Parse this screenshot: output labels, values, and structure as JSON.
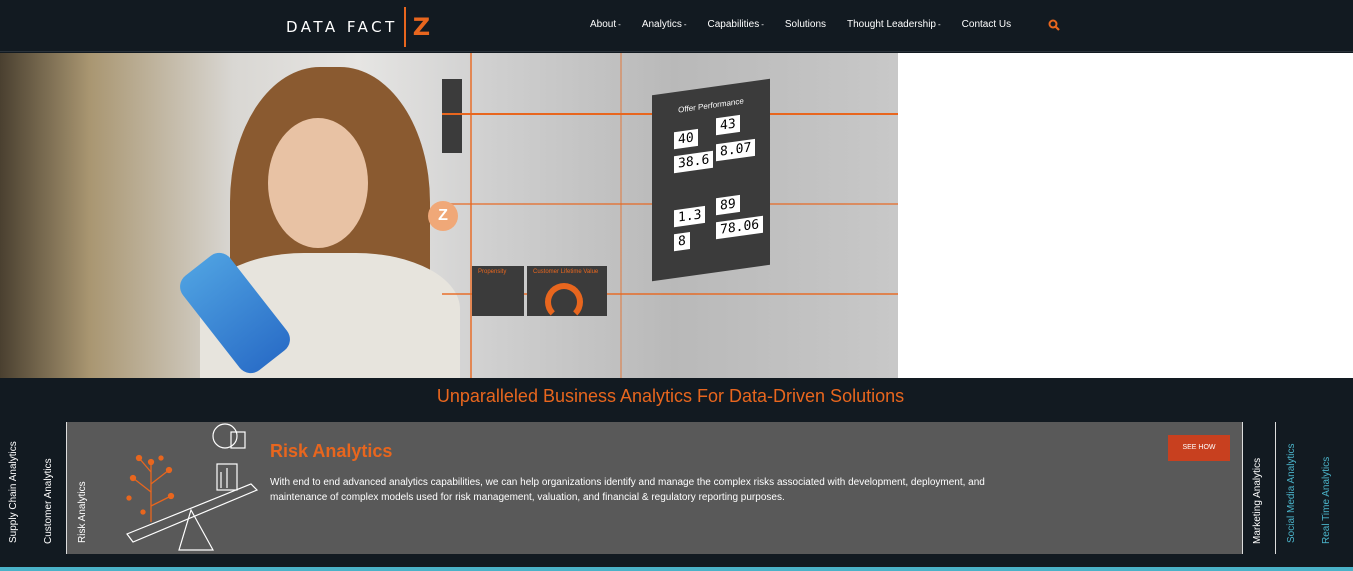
{
  "brand": {
    "logo_text": "DATA FACT",
    "logo_mark": "Z",
    "accent": "#e8661e"
  },
  "nav": {
    "items": [
      {
        "label": "About",
        "caret": "-"
      },
      {
        "label": "Analytics",
        "caret": "-"
      },
      {
        "label": "Capabilities",
        "caret": "-"
      },
      {
        "label": "Solutions",
        "caret": ""
      },
      {
        "label": "Thought Leadership",
        "caret": "-"
      },
      {
        "label": "Contact Us",
        "caret": ""
      }
    ],
    "search_icon": "search-icon"
  },
  "hero": {
    "panel_title": "Offer Performance",
    "values": [
      "40",
      "43",
      "38.6",
      "8.07",
      "1.3",
      "89",
      "8",
      "78.06"
    ],
    "gauge_titles": [
      "Propensity",
      "Customer Lifetime Value"
    ]
  },
  "headline": "Unparalleled Business Analytics For Data-Driven Solutions",
  "tabs": {
    "left": [
      "Supply Chain Analytics",
      "Customer Analytics",
      "Risk Analytics"
    ],
    "right": [
      "Marketing Analytics",
      "Social Media Analytics",
      "Real Time Analytics"
    ]
  },
  "card": {
    "title": "Risk Analytics",
    "description": "With end to end advanced analytics capabilities, we can help organizations identify and manage the complex risks associated with development, deployment, and maintenance of complex models used for risk management, valuation, and financial & regulatory reporting purposes.",
    "button": "SEE HOW"
  }
}
